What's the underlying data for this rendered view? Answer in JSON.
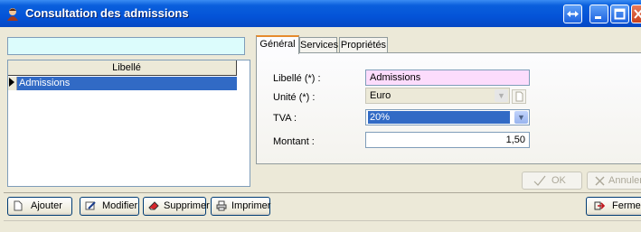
{
  "window": {
    "title": "Consultation des admissions"
  },
  "search": {
    "value": ""
  },
  "list": {
    "header": "Libellé",
    "rows": [
      {
        "label": "Admissions"
      }
    ]
  },
  "tabs": [
    {
      "label": "Général",
      "active": true
    },
    {
      "label": "Services",
      "active": false
    },
    {
      "label": "Propriétés",
      "active": false
    }
  ],
  "form": {
    "libelle": {
      "label": "Libellé (*) :",
      "value": "Admissions"
    },
    "unite": {
      "label": "Unité (*) :",
      "value": "Euro"
    },
    "tva": {
      "label": "TVA :",
      "value": "20%"
    },
    "montant": {
      "label": "Montant :",
      "value": "1,50"
    }
  },
  "dialog_buttons": {
    "ok": "OK",
    "annuler": "Annuler"
  },
  "toolbar": {
    "ajouter": "Ajouter",
    "modifier": "Modifier",
    "supprimer": "Supprimer",
    "imprimer": "Imprimer",
    "fermer": "Fermer"
  },
  "colors": {
    "titlebar": "#0454d8",
    "selection": "#316ac5",
    "required_field": "#fcdcfc",
    "search_field": "#dcfcfc"
  }
}
